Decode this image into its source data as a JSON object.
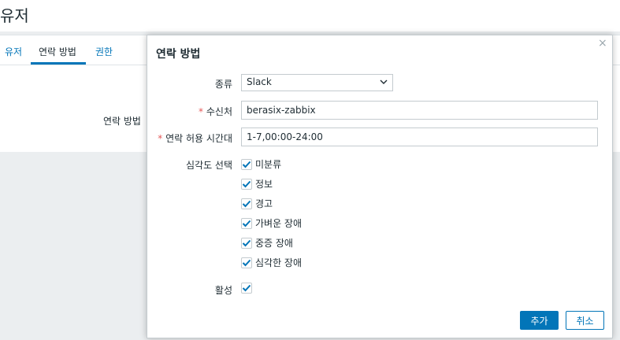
{
  "page": {
    "title": "유저",
    "tabs": [
      {
        "label": "유저",
        "active": false
      },
      {
        "label": "연락 방법",
        "active": true
      },
      {
        "label": "권한",
        "active": false
      }
    ],
    "bg_field_label": "연락 방법"
  },
  "dialog": {
    "title": "연락 방법",
    "close_glyph": "×",
    "type": {
      "label": "종류",
      "value": "Slack"
    },
    "send_to": {
      "required": "*",
      "label": "수신처",
      "value": "berasix-zabbix"
    },
    "when_active": {
      "required": "*",
      "label": "연락 허용 시간대",
      "value": "1-7,00:00-24:00"
    },
    "severity": {
      "label": "심각도 선택",
      "options": [
        {
          "label": "미분류",
          "checked": true
        },
        {
          "label": "정보",
          "checked": true
        },
        {
          "label": "경고",
          "checked": true
        },
        {
          "label": "가벼운 장애",
          "checked": true
        },
        {
          "label": "중증 장애",
          "checked": true
        },
        {
          "label": "심각한 장애",
          "checked": true
        }
      ]
    },
    "enabled": {
      "label": "활성",
      "checked": true
    },
    "buttons": {
      "add": "추가",
      "cancel": "취소"
    }
  },
  "colors": {
    "accent": "#0275b8",
    "required": "#e45959"
  }
}
